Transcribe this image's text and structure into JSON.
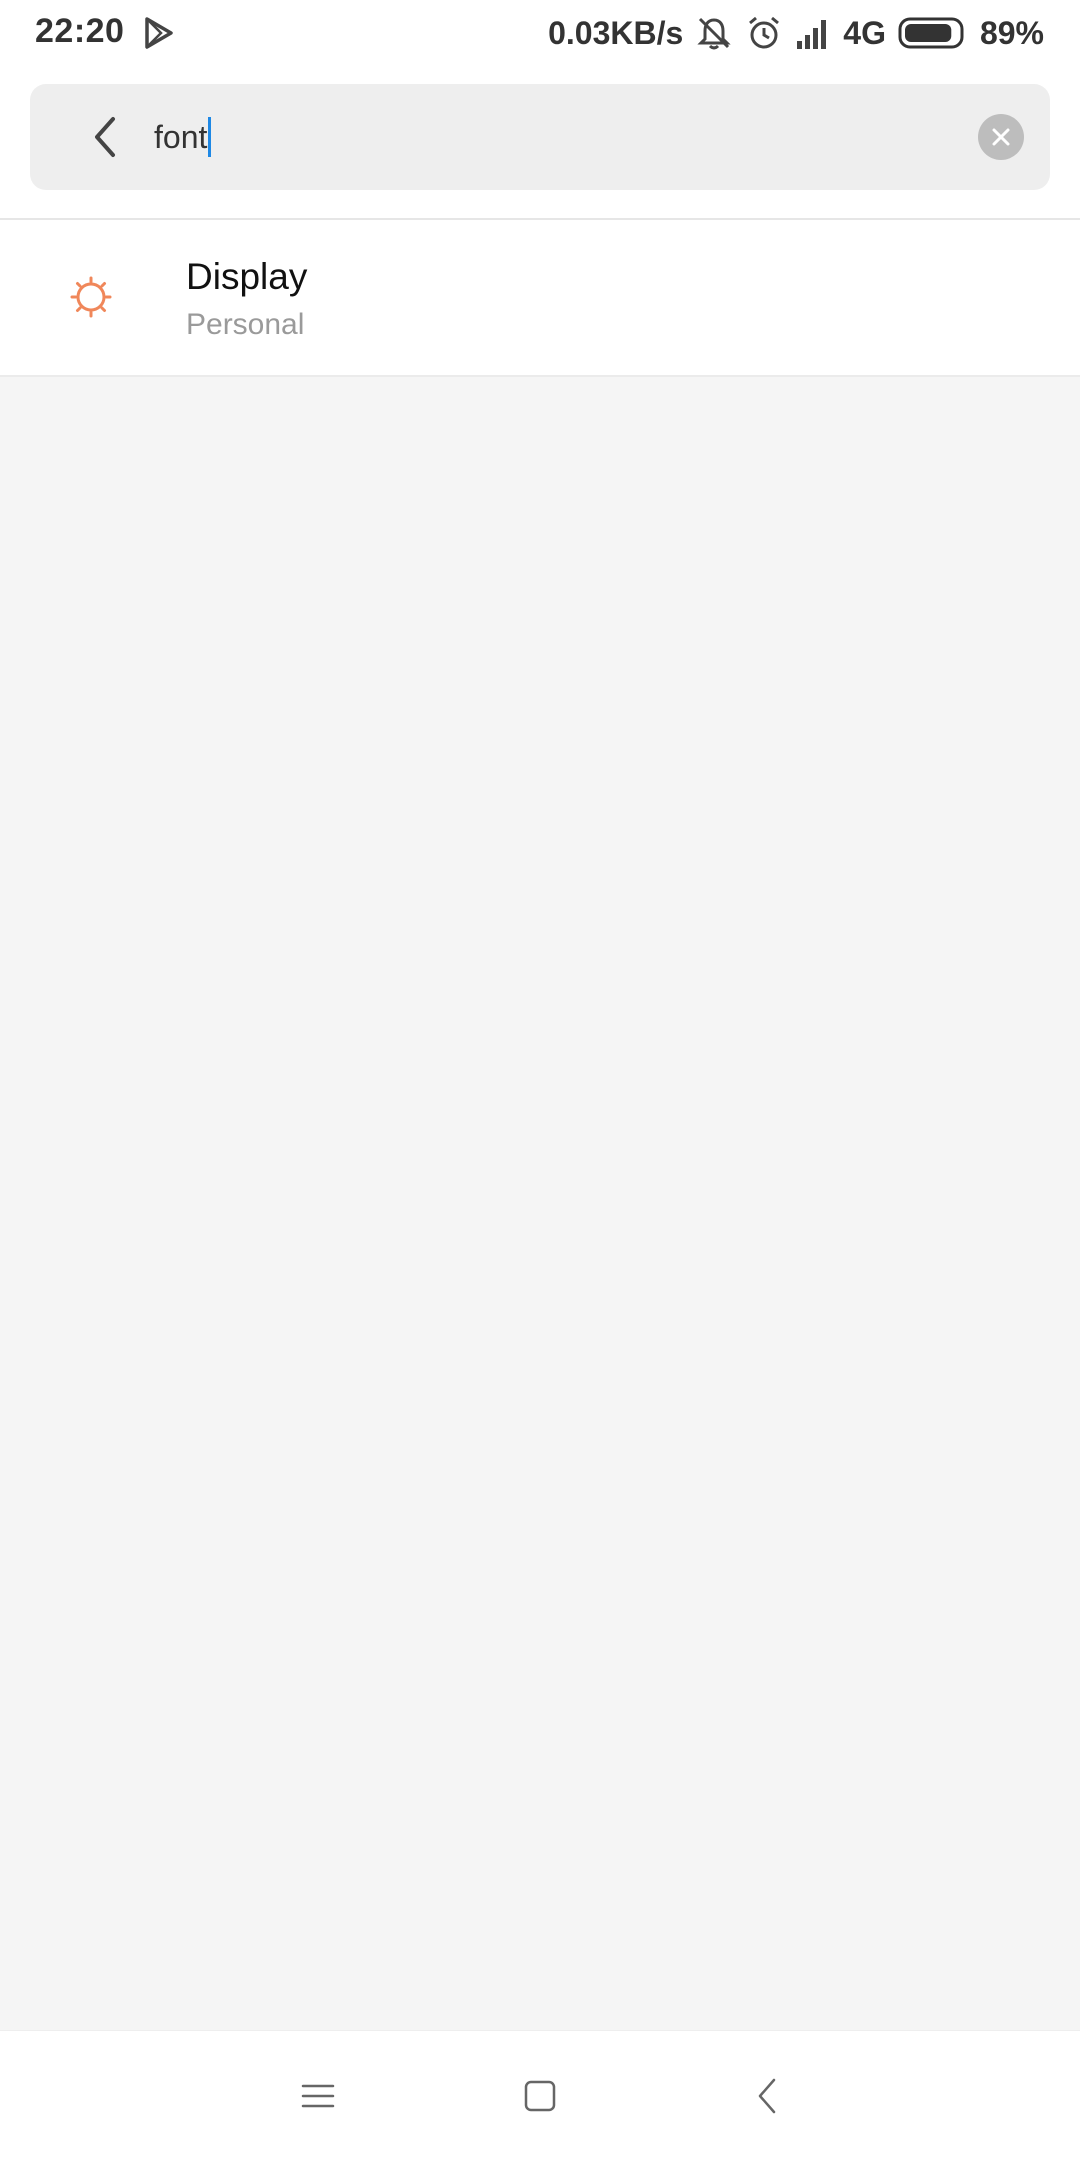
{
  "status_bar": {
    "time": "22:20",
    "network_speed": "0.03KB/s",
    "network_type": "4G",
    "battery_percent": "89%",
    "battery_level": 0.89,
    "icons": [
      "play-store-icon",
      "mute-icon",
      "alarm-icon",
      "signal-icon",
      "battery-icon"
    ]
  },
  "search": {
    "query": "font"
  },
  "results": [
    {
      "title": "Display",
      "subtitle": "Personal",
      "icon": "brightness-icon",
      "icon_color": "#f0875a"
    }
  ],
  "colors": {
    "accent": "#1e88e5",
    "icon_orange": "#f0875a",
    "background": "#f5f5f5"
  }
}
